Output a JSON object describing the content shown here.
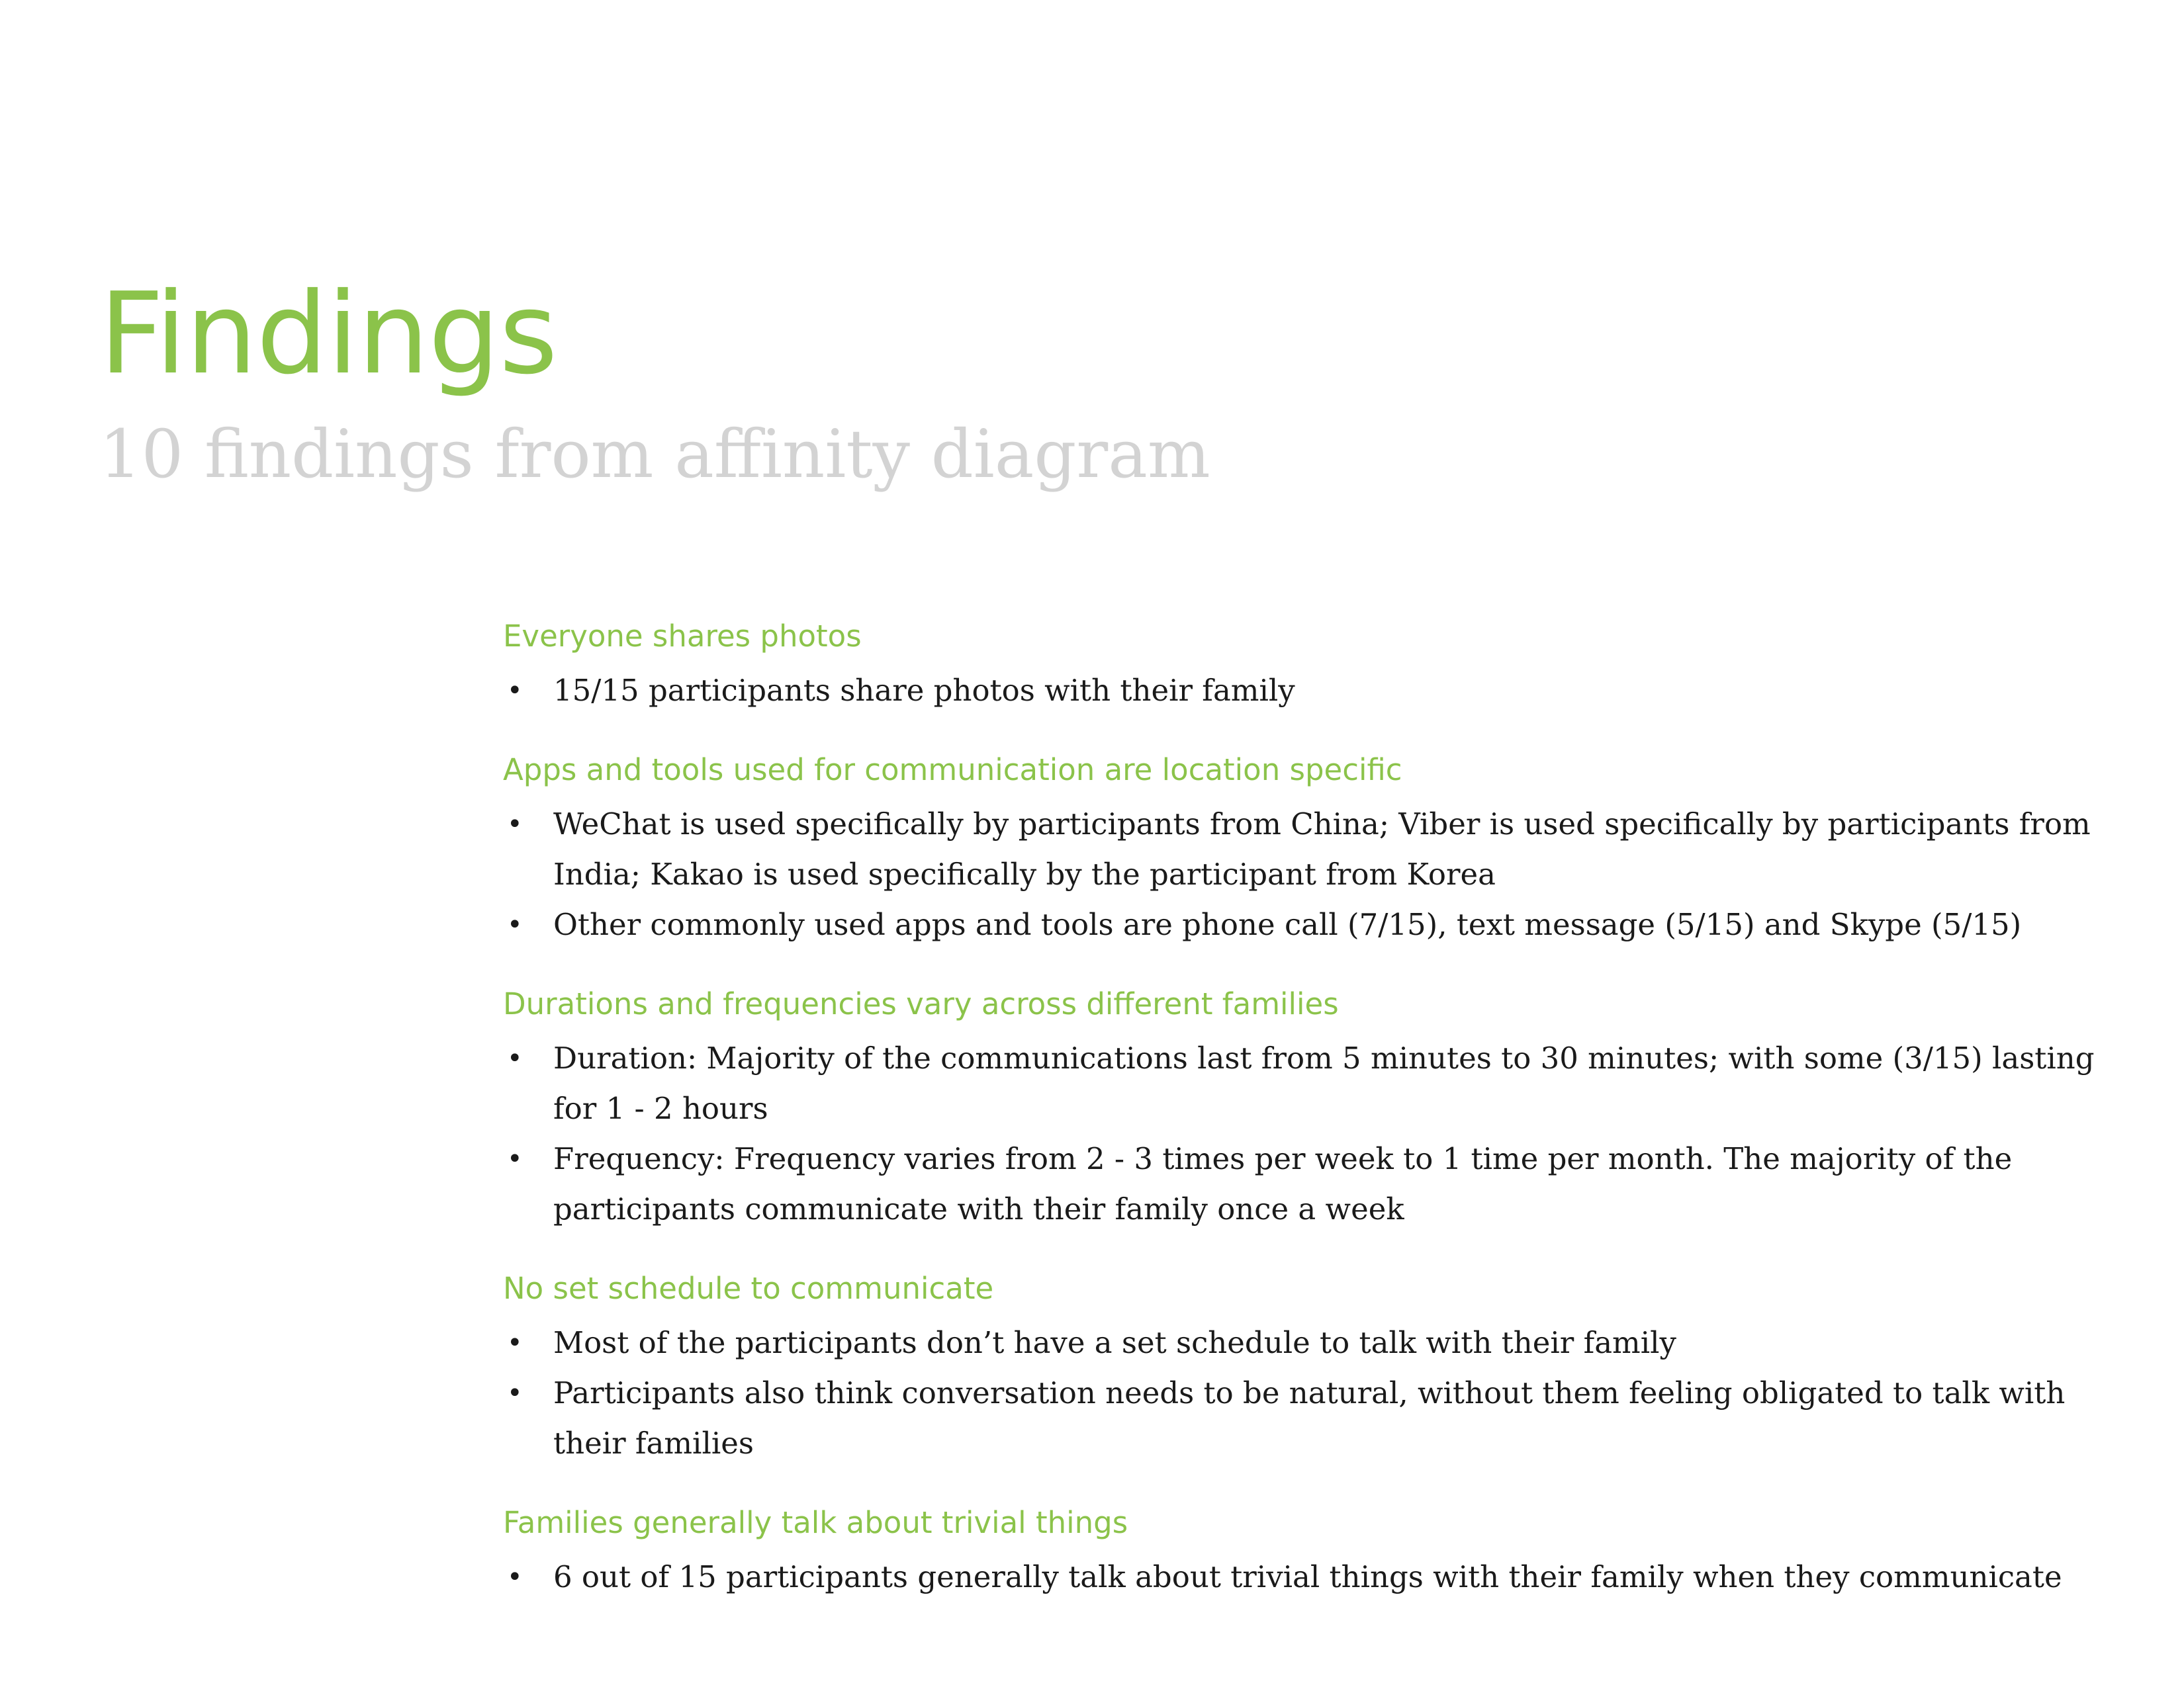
{
  "page": {
    "title": "Findings",
    "subtitle": "10 findings from affinity diagram"
  },
  "findings": [
    {
      "heading": "Everyone shares photos",
      "bullets": [
        "15/15 participants share photos with their family"
      ]
    },
    {
      "heading": "Apps and tools used for communication are location specific",
      "bullets": [
        "WeChat is used specifically by participants from China; Viber is used specifically by participants from India; Kakao is used specifically by the participant from Korea",
        "Other commonly used apps and tools are phone call (7/15), text message (5/15) and Skype (5/15)"
      ]
    },
    {
      "heading": "Durations and frequencies vary across different families",
      "bullets": [
        "Duration: Majority of the communications last from 5 minutes to 30 minutes; with some (3/15) lasting for 1 - 2 hours",
        "Frequency: Frequency varies from 2 - 3 times per week to 1 time per month. The majority of the participants communicate with their family once a week"
      ]
    },
    {
      "heading": "No set schedule to communicate",
      "bullets": [
        "Most of the participants don’t have a set schedule to talk with their family",
        "Participants also think conversation needs to be natural, without them feeling obligated to talk with their families"
      ]
    },
    {
      "heading": "Families generally talk about trivial things",
      "bullets": [
        "6 out of 15 participants generally talk about trivial things with their family when they communicate"
      ]
    }
  ],
  "theme": {
    "accent": "#8bc34a",
    "subtitle_color": "#d3d3d3",
    "body_color": "#1a1a1a"
  }
}
